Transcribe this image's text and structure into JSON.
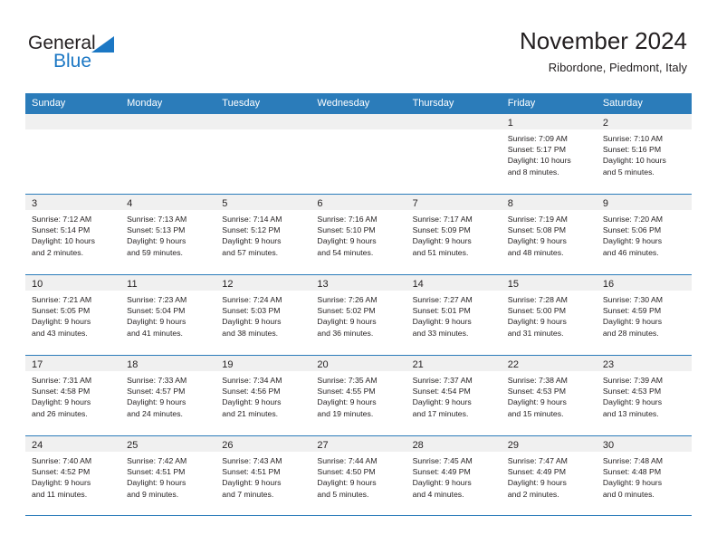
{
  "brand": {
    "name_part1": "General",
    "name_part2": "Blue",
    "triangle_icon": "triangle-icon",
    "colors": {
      "blue": "#1b77c4",
      "header_blue": "#2b7cba",
      "band_gray": "#f0f0f0",
      "text": "#231f20"
    }
  },
  "header": {
    "title": "November 2024",
    "subtitle": "Ribordone, Piedmont, Italy"
  },
  "weekdays": [
    "Sunday",
    "Monday",
    "Tuesday",
    "Wednesday",
    "Thursday",
    "Friday",
    "Saturday"
  ],
  "weeks": [
    [
      {
        "day": "",
        "lines": []
      },
      {
        "day": "",
        "lines": []
      },
      {
        "day": "",
        "lines": []
      },
      {
        "day": "",
        "lines": []
      },
      {
        "day": "",
        "lines": []
      },
      {
        "day": "1",
        "lines": [
          "Sunrise: 7:09 AM",
          "Sunset: 5:17 PM",
          "Daylight: 10 hours",
          "and 8 minutes."
        ]
      },
      {
        "day": "2",
        "lines": [
          "Sunrise: 7:10 AM",
          "Sunset: 5:16 PM",
          "Daylight: 10 hours",
          "and 5 minutes."
        ]
      }
    ],
    [
      {
        "day": "3",
        "lines": [
          "Sunrise: 7:12 AM",
          "Sunset: 5:14 PM",
          "Daylight: 10 hours",
          "and 2 minutes."
        ]
      },
      {
        "day": "4",
        "lines": [
          "Sunrise: 7:13 AM",
          "Sunset: 5:13 PM",
          "Daylight: 9 hours",
          "and 59 minutes."
        ]
      },
      {
        "day": "5",
        "lines": [
          "Sunrise: 7:14 AM",
          "Sunset: 5:12 PM",
          "Daylight: 9 hours",
          "and 57 minutes."
        ]
      },
      {
        "day": "6",
        "lines": [
          "Sunrise: 7:16 AM",
          "Sunset: 5:10 PM",
          "Daylight: 9 hours",
          "and 54 minutes."
        ]
      },
      {
        "day": "7",
        "lines": [
          "Sunrise: 7:17 AM",
          "Sunset: 5:09 PM",
          "Daylight: 9 hours",
          "and 51 minutes."
        ]
      },
      {
        "day": "8",
        "lines": [
          "Sunrise: 7:19 AM",
          "Sunset: 5:08 PM",
          "Daylight: 9 hours",
          "and 48 minutes."
        ]
      },
      {
        "day": "9",
        "lines": [
          "Sunrise: 7:20 AM",
          "Sunset: 5:06 PM",
          "Daylight: 9 hours",
          "and 46 minutes."
        ]
      }
    ],
    [
      {
        "day": "10",
        "lines": [
          "Sunrise: 7:21 AM",
          "Sunset: 5:05 PM",
          "Daylight: 9 hours",
          "and 43 minutes."
        ]
      },
      {
        "day": "11",
        "lines": [
          "Sunrise: 7:23 AM",
          "Sunset: 5:04 PM",
          "Daylight: 9 hours",
          "and 41 minutes."
        ]
      },
      {
        "day": "12",
        "lines": [
          "Sunrise: 7:24 AM",
          "Sunset: 5:03 PM",
          "Daylight: 9 hours",
          "and 38 minutes."
        ]
      },
      {
        "day": "13",
        "lines": [
          "Sunrise: 7:26 AM",
          "Sunset: 5:02 PM",
          "Daylight: 9 hours",
          "and 36 minutes."
        ]
      },
      {
        "day": "14",
        "lines": [
          "Sunrise: 7:27 AM",
          "Sunset: 5:01 PM",
          "Daylight: 9 hours",
          "and 33 minutes."
        ]
      },
      {
        "day": "15",
        "lines": [
          "Sunrise: 7:28 AM",
          "Sunset: 5:00 PM",
          "Daylight: 9 hours",
          "and 31 minutes."
        ]
      },
      {
        "day": "16",
        "lines": [
          "Sunrise: 7:30 AM",
          "Sunset: 4:59 PM",
          "Daylight: 9 hours",
          "and 28 minutes."
        ]
      }
    ],
    [
      {
        "day": "17",
        "lines": [
          "Sunrise: 7:31 AM",
          "Sunset: 4:58 PM",
          "Daylight: 9 hours",
          "and 26 minutes."
        ]
      },
      {
        "day": "18",
        "lines": [
          "Sunrise: 7:33 AM",
          "Sunset: 4:57 PM",
          "Daylight: 9 hours",
          "and 24 minutes."
        ]
      },
      {
        "day": "19",
        "lines": [
          "Sunrise: 7:34 AM",
          "Sunset: 4:56 PM",
          "Daylight: 9 hours",
          "and 21 minutes."
        ]
      },
      {
        "day": "20",
        "lines": [
          "Sunrise: 7:35 AM",
          "Sunset: 4:55 PM",
          "Daylight: 9 hours",
          "and 19 minutes."
        ]
      },
      {
        "day": "21",
        "lines": [
          "Sunrise: 7:37 AM",
          "Sunset: 4:54 PM",
          "Daylight: 9 hours",
          "and 17 minutes."
        ]
      },
      {
        "day": "22",
        "lines": [
          "Sunrise: 7:38 AM",
          "Sunset: 4:53 PM",
          "Daylight: 9 hours",
          "and 15 minutes."
        ]
      },
      {
        "day": "23",
        "lines": [
          "Sunrise: 7:39 AM",
          "Sunset: 4:53 PM",
          "Daylight: 9 hours",
          "and 13 minutes."
        ]
      }
    ],
    [
      {
        "day": "24",
        "lines": [
          "Sunrise: 7:40 AM",
          "Sunset: 4:52 PM",
          "Daylight: 9 hours",
          "and 11 minutes."
        ]
      },
      {
        "day": "25",
        "lines": [
          "Sunrise: 7:42 AM",
          "Sunset: 4:51 PM",
          "Daylight: 9 hours",
          "and 9 minutes."
        ]
      },
      {
        "day": "26",
        "lines": [
          "Sunrise: 7:43 AM",
          "Sunset: 4:51 PM",
          "Daylight: 9 hours",
          "and 7 minutes."
        ]
      },
      {
        "day": "27",
        "lines": [
          "Sunrise: 7:44 AM",
          "Sunset: 4:50 PM",
          "Daylight: 9 hours",
          "and 5 minutes."
        ]
      },
      {
        "day": "28",
        "lines": [
          "Sunrise: 7:45 AM",
          "Sunset: 4:49 PM",
          "Daylight: 9 hours",
          "and 4 minutes."
        ]
      },
      {
        "day": "29",
        "lines": [
          "Sunrise: 7:47 AM",
          "Sunset: 4:49 PM",
          "Daylight: 9 hours",
          "and 2 minutes."
        ]
      },
      {
        "day": "30",
        "lines": [
          "Sunrise: 7:48 AM",
          "Sunset: 4:48 PM",
          "Daylight: 9 hours",
          "and 0 minutes."
        ]
      }
    ]
  ]
}
